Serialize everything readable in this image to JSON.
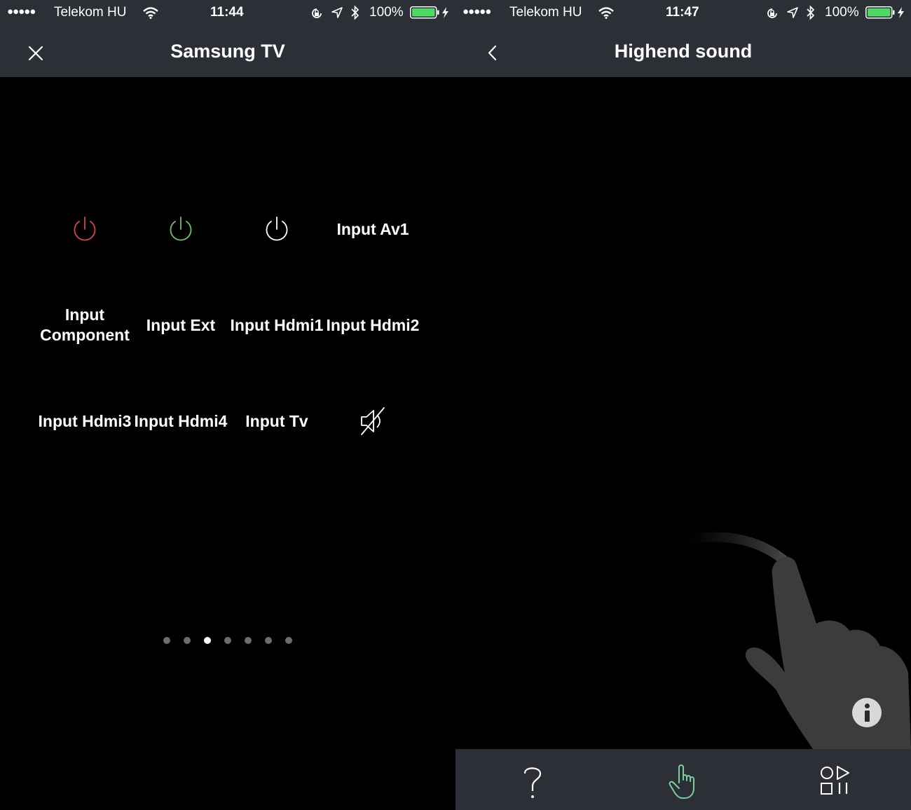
{
  "left_screen": {
    "status": {
      "carrier": "Telekom HU",
      "time": "11:44",
      "battery": "100%"
    },
    "title": "Samsung TV",
    "grid": [
      {
        "label": "",
        "icon": "power-icon",
        "color": "#d64545"
      },
      {
        "label": "",
        "icon": "power-icon",
        "color": "#67c36a"
      },
      {
        "label": "",
        "icon": "power-icon",
        "color": "#ffffff"
      },
      {
        "label": "Input Av1"
      },
      {
        "label": "Input Component"
      },
      {
        "label": "Input Ext"
      },
      {
        "label": "Input Hdmi1"
      },
      {
        "label": "Input Hdmi2"
      },
      {
        "label": "Input Hdmi3"
      },
      {
        "label": "Input Hdmi4"
      },
      {
        "label": "Input Tv"
      },
      {
        "label": "",
        "icon": "mute-icon",
        "color": "#ffffff"
      }
    ],
    "pager": {
      "count": 7,
      "active_index": 2
    }
  },
  "right_screen": {
    "status": {
      "carrier": "Telekom HU",
      "time": "11:47",
      "battery": "100%"
    },
    "title": "Highend sound",
    "tabbar": {
      "items": [
        {
          "icon": "help-icon",
          "active": false
        },
        {
          "icon": "hand-pointer-icon",
          "active": true
        },
        {
          "icon": "media-controls-icon",
          "active": false
        }
      ],
      "active_color": "#7ccf9a"
    }
  },
  "colors": {
    "bar_background": "#2c2f35",
    "battery_fill": "#4cd964",
    "power_red": "#d64545",
    "power_green": "#67c36a"
  }
}
